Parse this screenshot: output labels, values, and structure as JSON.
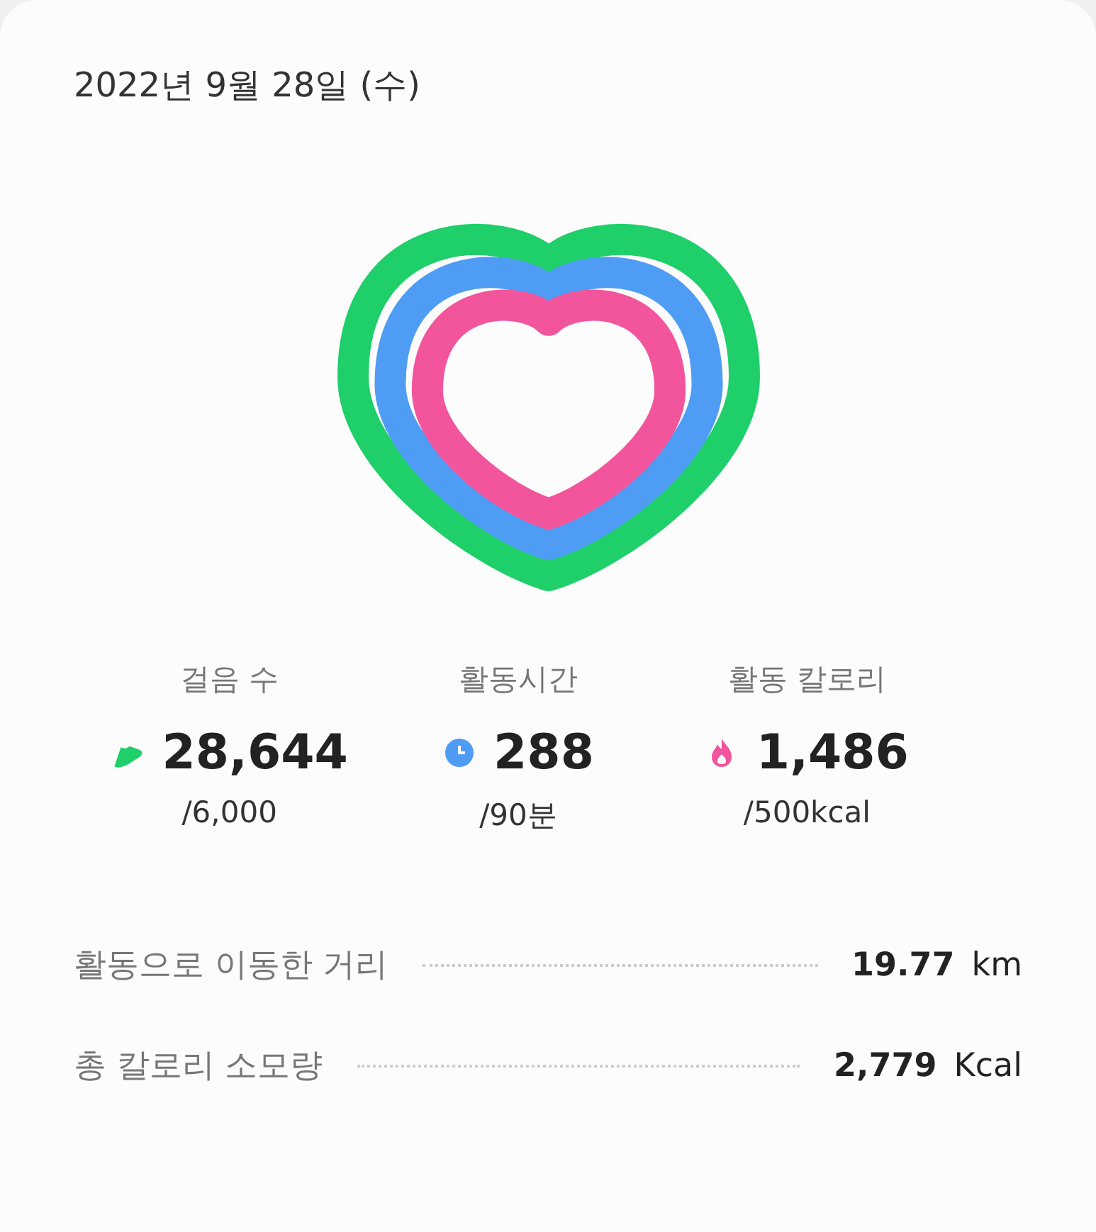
{
  "date": "2022년 9월 28일 (수)",
  "stats": [
    {
      "kind": "steps",
      "label": "걸음 수",
      "value": "28,644",
      "goal": "/6,000",
      "color": "#1fcf6a"
    },
    {
      "kind": "time",
      "label": "활동시간",
      "value": "288",
      "goal": "/90분",
      "color": "#4f9cf5"
    },
    {
      "kind": "calories",
      "label": "활동 칼로리",
      "value": "1,486",
      "goal": "/500kcal",
      "color": "#f2559c"
    }
  ],
  "summary": [
    {
      "label": "활동으로 이동한 거리",
      "value": "19.77",
      "unit": "km"
    },
    {
      "label": "총 칼로리 소모량",
      "value": "2,779",
      "unit": "Kcal"
    }
  ]
}
